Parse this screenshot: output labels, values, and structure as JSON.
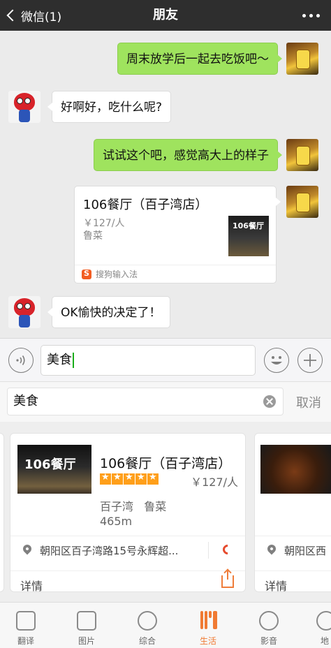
{
  "header": {
    "back_label": "微信(1)",
    "title": "朋友"
  },
  "messages": [
    {
      "side": "me",
      "text": "周末放学后一起去吃饭吧～"
    },
    {
      "side": "friend",
      "text": "好啊好，吃什么呢?"
    },
    {
      "side": "me",
      "text": "试试这个吧，感觉高大上的样子"
    },
    {
      "side": "friend",
      "text": "OK愉快的决定了！"
    }
  ],
  "shared_card": {
    "title": "106餐厅（百子湾店）",
    "price": "￥127/人",
    "category": "鲁菜",
    "thumb_text": "106餐厅",
    "source": "搜狗输入法"
  },
  "input": {
    "value": "美食"
  },
  "search": {
    "value": "美食",
    "cancel_label": "取消"
  },
  "result_card": {
    "name": "106餐厅（百子湾店）",
    "rating_stars": 5,
    "price": "￥127/人",
    "area": "百子湾   鲁菜",
    "distance": "465m",
    "address": "朝阳区百子湾路15号永辉超...",
    "detail_label": "详情",
    "thumb_text": "106餐厅"
  },
  "result_card_next": {
    "address": "朝阳区西",
    "detail_label": "详情"
  },
  "tabs": [
    {
      "label": "翻译",
      "icon": "translate-icon",
      "active": false
    },
    {
      "label": "图片",
      "icon": "image-icon",
      "active": false
    },
    {
      "label": "综合",
      "icon": "globe-icon",
      "active": false
    },
    {
      "label": "生活",
      "icon": "fork-knife-icon",
      "active": true
    },
    {
      "label": "影音",
      "icon": "film-reel-icon",
      "active": false
    },
    {
      "label": "地",
      "icon": "map-icon",
      "active": false
    }
  ],
  "colors": {
    "header_bg": "#2e2e2e",
    "my_bubble": "#9fe35e",
    "accent": "#f07a33"
  }
}
